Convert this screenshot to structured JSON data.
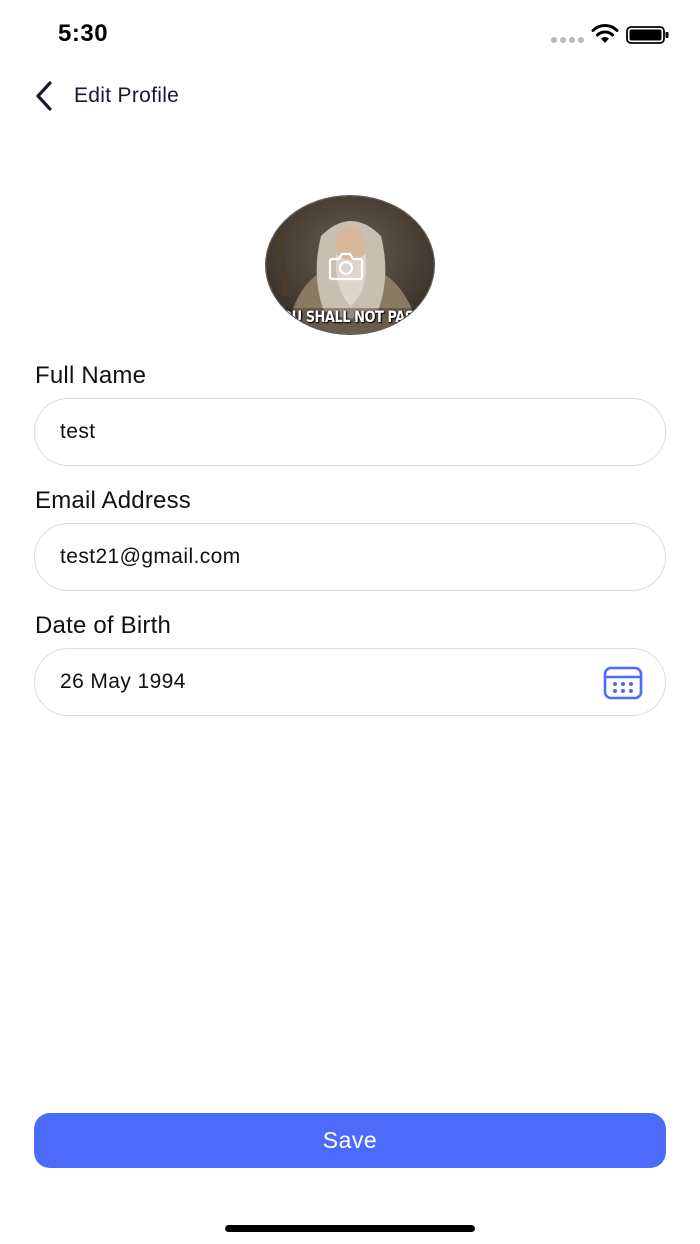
{
  "status_bar": {
    "time": "5:30"
  },
  "nav": {
    "title": "Edit Profile",
    "back_icon": "chevron-left-icon"
  },
  "avatar": {
    "caption": "YOU SHALL NOT PASS!",
    "overlay_icon": "camera-icon"
  },
  "form": {
    "full_name": {
      "label": "Full Name",
      "value": "test"
    },
    "email": {
      "label": "Email Address",
      "value": "test21@gmail.com"
    },
    "dob": {
      "label": "Date of Birth",
      "value": "26 May 1994",
      "icon": "calendar-icon"
    }
  },
  "actions": {
    "save_label": "Save"
  },
  "colors": {
    "accent": "#4d6bfa",
    "input_border": "#dcdcdc",
    "nav_text": "#1a1a2e"
  }
}
